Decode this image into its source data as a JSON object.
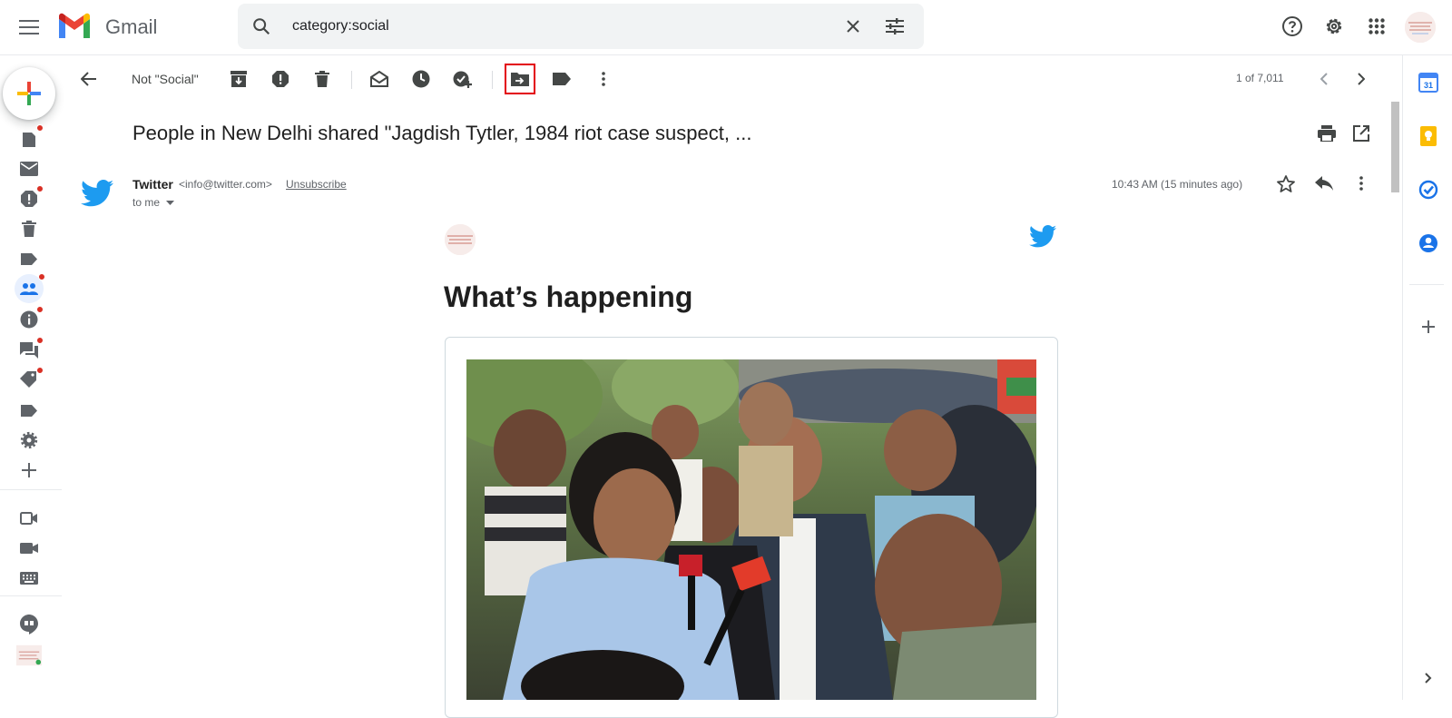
{
  "app": {
    "name": "Gmail"
  },
  "search": {
    "value": "category:social"
  },
  "toolbar": {
    "not_social_label": "Not \"Social\"",
    "pager": "1 of 7,011"
  },
  "email": {
    "subject": "People in New Delhi shared \"Jagdish Tytler, 1984 riot case suspect, ...",
    "sender_name": "Twitter",
    "sender_email": "<info@twitter.com>",
    "unsubscribe_label": "Unsubscribe",
    "recipient": "to me",
    "timestamp": "10:43 AM (15 minutes ago)"
  },
  "body": {
    "headline": "What’s happening"
  },
  "right_panel": {
    "calendar_day": "31"
  },
  "colors": {
    "accent_red": "#d93025",
    "twitter_blue": "#1d9bf0",
    "highlight_box": "#e3000f"
  }
}
